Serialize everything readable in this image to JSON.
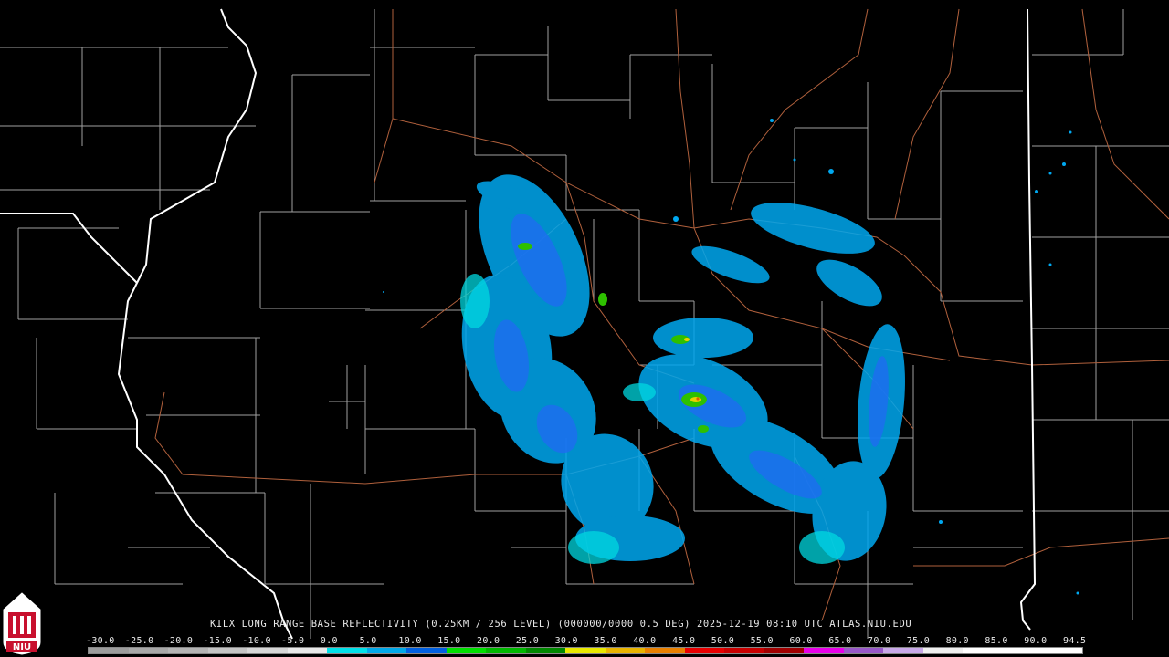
{
  "header": {
    "caption": "KILX LONG RANGE BASE REFLECTIVITY (0.25KM / 256 LEVEL) (000000/0000 0.5 DEG) 2025-12-19 08:10 UTC  ATLAS.NIU.EDU"
  },
  "logo": {
    "text": "NIU"
  },
  "scale": {
    "labels": [
      "-30.0",
      "-25.0",
      "-20.0",
      "-15.0",
      "-10.0",
      "-5.0",
      "0.0",
      "5.0",
      "10.0",
      "15.0",
      "20.0",
      "25.0",
      "30.0",
      "35.0",
      "40.0",
      "45.0",
      "50.0",
      "55.0",
      "60.0",
      "65.0",
      "70.0",
      "75.0",
      "80.0",
      "85.0",
      "90.0",
      "94.5"
    ],
    "colors": [
      "#9c9c9c",
      "#a8a8a8",
      "#b4b4b4",
      "#c4c4c4",
      "#d6d6d6",
      "#e8e8e8",
      "#00e0e8",
      "#00a8e8",
      "#0060e0",
      "#00e000",
      "#00b800",
      "#008800",
      "#e8e800",
      "#e8b400",
      "#e88000",
      "#e80000",
      "#c80000",
      "#a00000",
      "#e800e8",
      "#9858c8",
      "#c8a8e8",
      "#f0f0f0",
      "#ffffff",
      "#ffffff",
      "#ffffff"
    ]
  },
  "map_layers": {
    "state_border_color": "#ffffff",
    "county_border_color": "#a0a0a0",
    "highway_color": "#b0603c",
    "reflectivity_colors": [
      "#00a8f0",
      "#1e6cf0",
      "#00d8e0",
      "#2ec000",
      "#e8d000",
      "#e06000"
    ]
  }
}
